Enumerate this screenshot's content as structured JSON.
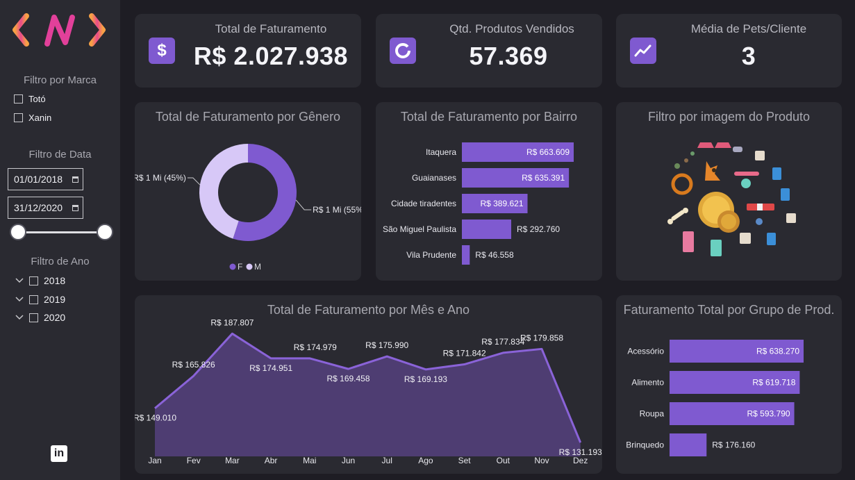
{
  "sidebar": {
    "brand_filter_title": "Filtro por Marca",
    "brands": [
      "Totó",
      "Xanin"
    ],
    "date_filter_title": "Filtro de Data",
    "date_start": "01/01/2018",
    "date_end": "31/12/2020",
    "year_filter_title": "Filtro de Ano",
    "years": [
      "2018",
      "2019",
      "2020"
    ],
    "linkedin_label": "in"
  },
  "kpis": [
    {
      "label": "Total de Faturamento",
      "value": "R$ 2.027.938",
      "icon": "dollar-icon"
    },
    {
      "label": "Qtd. Produtos Vendidos",
      "value": "57.369",
      "icon": "donut-icon"
    },
    {
      "label": "Média de Pets/Cliente",
      "value": "3",
      "icon": "trend-icon"
    }
  ],
  "colors": {
    "accent": "#7f5ad0",
    "accent_light": "#d7c8f7",
    "area": "#4e3d72",
    "line": "#8a63d8"
  },
  "chart_data": [
    {
      "type": "pie",
      "title": "Total de Faturamento por Gênero",
      "categories": [
        "F",
        "M"
      ],
      "values": [
        55,
        45
      ],
      "labels": [
        "R$ 1 Mi (55%)",
        "R$ 1 Mi (45%)"
      ],
      "legend": "bottom"
    },
    {
      "type": "bar",
      "orientation": "horizontal",
      "title": "Total de Faturamento por Bairro",
      "categories": [
        "Itaquera",
        "Guaianases",
        "Cidade tiradentes",
        "São Miguel Paulista",
        "Vila Prudente"
      ],
      "values": [
        663609,
        635391,
        389621,
        292760,
        46558
      ],
      "labels": [
        "R$ 663.609",
        "R$ 635.391",
        "R$ 389.621",
        "R$ 292.760",
        "R$ 46.558"
      ]
    },
    {
      "type": "area",
      "title": "Total de Faturamento por Mês e Ano",
      "categories": [
        "Jan",
        "Fev",
        "Mar",
        "Abr",
        "Mai",
        "Jun",
        "Jul",
        "Ago",
        "Set",
        "Out",
        "Nov",
        "Dez"
      ],
      "values": [
        149010,
        165826,
        187807,
        174951,
        174979,
        169458,
        175990,
        169193,
        171842,
        177834,
        179858,
        131193
      ],
      "labels": [
        "R$ 149.010",
        "R$ 165.826",
        "R$ 187.807",
        "R$ 174.951",
        "R$ 174.979",
        "R$ 169.458",
        "R$ 175.990",
        "R$ 169.193",
        "R$ 171.842",
        "R$ 177.834",
        "R$ 179.858",
        "R$ 131.193"
      ]
    },
    {
      "type": "bar",
      "orientation": "horizontal",
      "title": "Faturamento Total por Grupo de Prod.",
      "categories": [
        "Acessório",
        "Alimento",
        "Roupa",
        "Brinquedo"
      ],
      "values": [
        638270,
        619718,
        593790,
        176160
      ],
      "labels": [
        "R$ 638.270",
        "R$ 619.718",
        "R$ 593.790",
        "R$ 176.160"
      ]
    }
  ],
  "image_filter": {
    "title": "Filtro por imagem do Produto"
  }
}
